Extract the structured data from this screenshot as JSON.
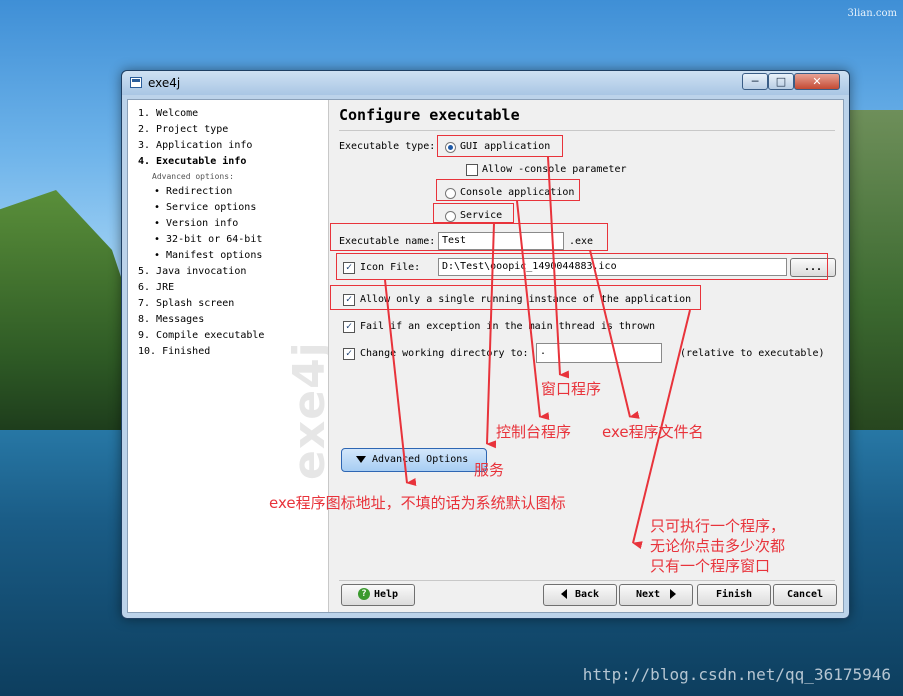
{
  "watermarks": {
    "top": "3lian.com",
    "bottom": "http://blog.csdn.net/qq_36175946"
  },
  "window": {
    "title": "exe4j",
    "min_label": "─",
    "max_label": "□",
    "close_label": "✕"
  },
  "sidebar": {
    "steps": [
      {
        "text": "1.  Welcome",
        "kind": "step"
      },
      {
        "text": "2.  Project type",
        "kind": "step"
      },
      {
        "text": "3.  Application info",
        "kind": "step"
      },
      {
        "text": "4.  Executable info",
        "kind": "bold"
      },
      {
        "text": "Advanced options:",
        "kind": "adv"
      },
      {
        "text": "• Redirection",
        "kind": "sub"
      },
      {
        "text": "• Service options",
        "kind": "sub"
      },
      {
        "text": "• Version info",
        "kind": "sub"
      },
      {
        "text": "• 32-bit or 64-bit",
        "kind": "sub"
      },
      {
        "text": "• Manifest options",
        "kind": "sub"
      },
      {
        "text": "5.  Java invocation",
        "kind": "step"
      },
      {
        "text": "6.  JRE",
        "kind": "step"
      },
      {
        "text": "7.  Splash screen",
        "kind": "step"
      },
      {
        "text": "8.  Messages",
        "kind": "step"
      },
      {
        "text": "9.  Compile executable",
        "kind": "step"
      },
      {
        "text": "10. Finished",
        "kind": "step"
      }
    ],
    "logo": "exe4j"
  },
  "main": {
    "heading": "Configure executable",
    "exe_type_label": "Executable type:",
    "gui_label": "GUI application",
    "allow_console_label": "Allow -console parameter",
    "console_label": "Console application",
    "service_label": "Service",
    "exe_name_label": "Executable name:",
    "exe_name_value": "Test",
    "exe_suffix": ".exe",
    "icon_file_label": "Icon File:",
    "icon_file_value": "D:\\Test\\ooopic_1490044883.ico",
    "browse_label": "...",
    "single_instance_label": "Allow only a single running instance of the application",
    "fail_label": "Fail if an exception in the main thread is thrown",
    "change_dir_label": "Change working directory to:",
    "change_dir_value": ".",
    "relative_label": "(relative to executable)",
    "advanced_label": "Advanced Options"
  },
  "footer": {
    "help": "Help",
    "back": "Back",
    "next": "Next",
    "finish": "Finish",
    "cancel": "Cancel"
  },
  "annotations": {
    "window_program": "窗口程序",
    "console_program": "控制台程序",
    "exe_name": "exe程序文件名",
    "service": "服务",
    "icon_path": "exe程序图标地址，不填的话为系统默认图标",
    "single_1": "只可执行一个程序，",
    "single_2": "无论你点击多少次都",
    "single_3": "只有一个程序窗口"
  },
  "colors": {
    "annotation": "#e8333b"
  }
}
